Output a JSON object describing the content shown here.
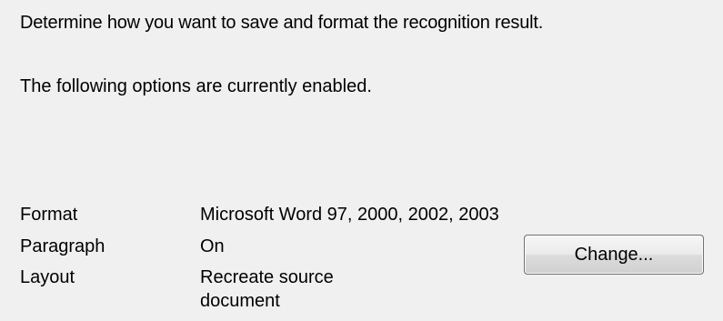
{
  "intro_text": "Determine how you want to save and format the recognition result.",
  "status_text": "The following options are currently enabled.",
  "options": [
    {
      "label": "Format",
      "value": "Microsoft Word 97, 2000, 2002, 2003"
    },
    {
      "label": "Paragraph",
      "value": "On"
    },
    {
      "label": "Layout",
      "value": "Recreate source document"
    }
  ],
  "change_button_label": "Change...",
  "colors": {
    "background": "#f0f0f0",
    "text": "#000000",
    "button_border": "#707070"
  }
}
